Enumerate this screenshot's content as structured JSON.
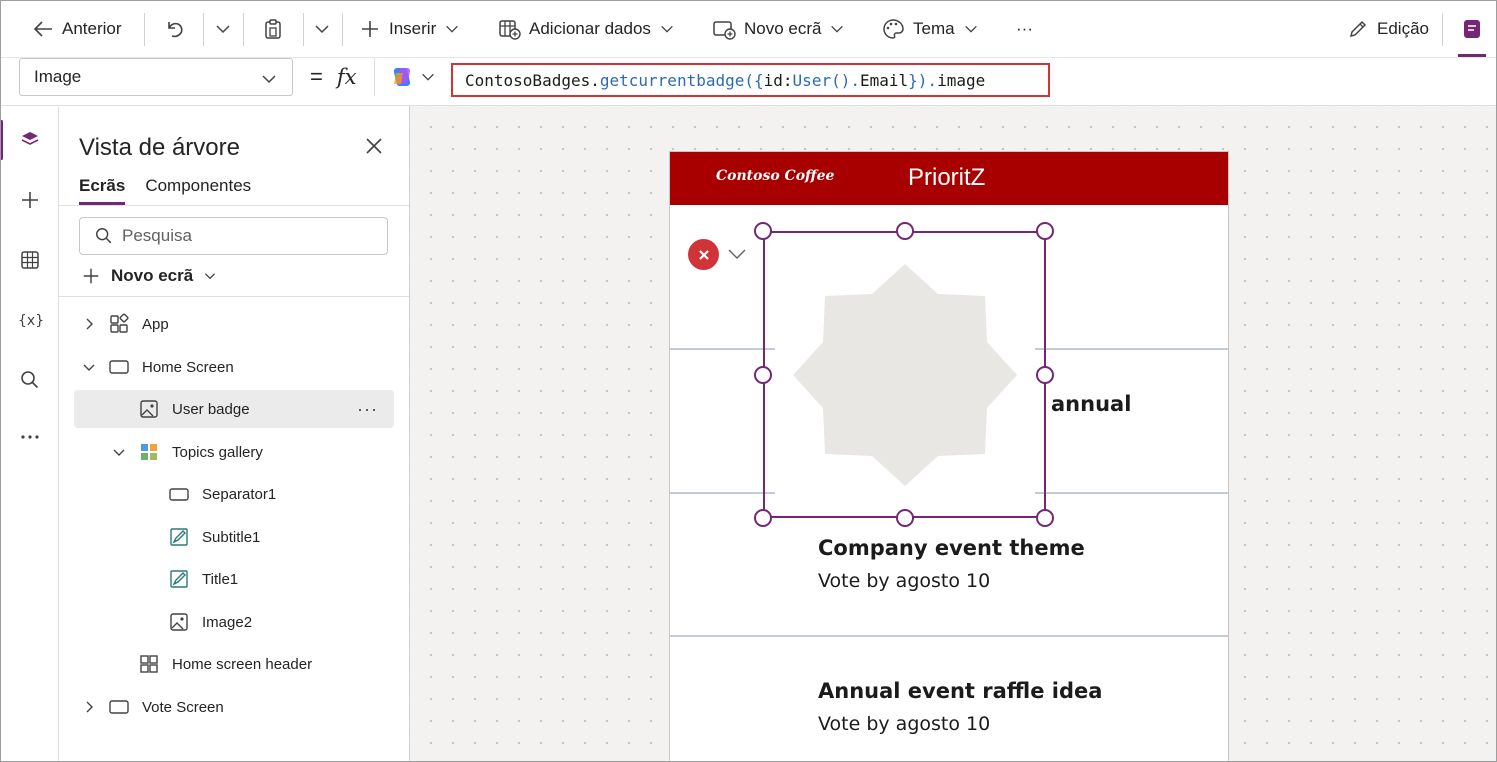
{
  "toolbar": {
    "back_label": "Anterior",
    "insert_label": "Inserir",
    "add_data_label": "Adicionar dados",
    "new_screen_label": "Novo ecrã",
    "theme_label": "Tema",
    "more_label": "···",
    "edit_label": "Edição"
  },
  "formula_bar": {
    "property": "Image",
    "equals": "=",
    "fx": "fx",
    "formula_parts": [
      "ContosoBadges",
      ".",
      "getcurrentbadge",
      "({",
      "id",
      ":",
      "User",
      "().",
      "Email",
      "}).",
      "image"
    ]
  },
  "tree_view": {
    "title": "Vista de árvore",
    "tabs": [
      {
        "label": "Ecrãs",
        "active": true
      },
      {
        "label": "Componentes",
        "active": false
      }
    ],
    "search_placeholder": "Pesquisa",
    "new_screen_label": "Novo ecrã",
    "nodes": [
      {
        "label": "App",
        "icon": "app-icon",
        "level": 0,
        "expander": "collapsed"
      },
      {
        "label": "Home Screen",
        "icon": "screen-icon",
        "level": 0,
        "expander": "expanded"
      },
      {
        "label": "User badge",
        "icon": "image-icon",
        "level": 1,
        "expander": "none",
        "selected": true
      },
      {
        "label": "Topics gallery",
        "icon": "gallery-icon",
        "level": 1,
        "expander": "expanded"
      },
      {
        "label": "Separator1",
        "icon": "rectangle-icon",
        "level": 2,
        "expander": "none"
      },
      {
        "label": "Subtitle1",
        "icon": "label-icon",
        "level": 2,
        "expander": "none"
      },
      {
        "label": "Title1",
        "icon": "label-icon",
        "level": 2,
        "expander": "none"
      },
      {
        "label": "Image2",
        "icon": "image-icon",
        "level": 2,
        "expander": "none"
      },
      {
        "label": "Home screen header",
        "icon": "component-icon",
        "level": 1,
        "expander": "none"
      },
      {
        "label": "Vote Screen",
        "icon": "screen-icon",
        "level": 0,
        "expander": "collapsed"
      }
    ]
  },
  "app_preview": {
    "logo_text": "Contoso Coffee",
    "title": "PrioritZ",
    "topics": [
      {
        "title": "annual",
        "subtitle": ""
      },
      {
        "title": "Company event theme",
        "subtitle": "Vote by agosto 10"
      },
      {
        "title": "Annual event raffle idea",
        "subtitle": "Vote by agosto 10"
      }
    ]
  },
  "colors": {
    "accent": "#742774",
    "header_red": "#a80000",
    "error_red": "#d13438",
    "formula_function": "#2b6bb5"
  }
}
